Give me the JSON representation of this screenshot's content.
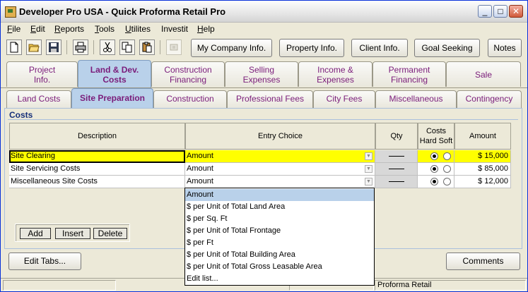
{
  "window": {
    "title": "Developer Pro  USA - Quick Proforma Retail Pro",
    "minimize_glyph": "_",
    "maximize_glyph": "□",
    "close_glyph": "✕"
  },
  "menu": [
    {
      "pre": "",
      "key": "F",
      "post": "ile"
    },
    {
      "pre": "",
      "key": "E",
      "post": "dit"
    },
    {
      "pre": "",
      "key": "R",
      "post": "eports"
    },
    {
      "pre": "",
      "key": "T",
      "post": "ools"
    },
    {
      "pre": "",
      "key": "U",
      "post": "tilites"
    },
    {
      "pre": "Investit",
      "key": "",
      "post": ""
    },
    {
      "pre": "",
      "key": "H",
      "post": "elp"
    }
  ],
  "toolbar": {
    "icons": [
      "new-document-icon",
      "open-folder-icon",
      "save-disk-icon",
      "print-icon",
      "cut-scissors-icon",
      "copy-icon",
      "paste-icon",
      "disabled-tool-icon"
    ],
    "my_company": "My Company Info.",
    "property": "Property Info.",
    "client": "Client Info.",
    "goal_seeking": "Goal Seeking",
    "notes": "Notes"
  },
  "main_tabs": [
    {
      "line1": "Project",
      "line2": "Info."
    },
    {
      "line1": "Land & Dev.",
      "line2": "Costs"
    },
    {
      "line1": "Construction",
      "line2": "Financing"
    },
    {
      "line1": "Selling",
      "line2": "Expenses"
    },
    {
      "line1": "Income &",
      "line2": "Expenses"
    },
    {
      "line1": "Permanent",
      "line2": "Financing"
    },
    {
      "line1": "Sale",
      "line2": ""
    }
  ],
  "sub_tabs": [
    "Land Costs",
    "Site Preparation",
    "Construction",
    "Professional Fees",
    "City Fees",
    "Miscellaneous",
    "Contingency"
  ],
  "section_label": "Costs",
  "grid": {
    "headers": {
      "description": "Description",
      "entry_choice": "Entry Choice",
      "qty": "Qty",
      "costs_line1": "Costs",
      "costs_line2": "Hard Soft",
      "amount": "Amount"
    },
    "rows": [
      {
        "description": "Site Clearing",
        "entry": "Amount",
        "hard_selected": true,
        "amount": "$ 15,000"
      },
      {
        "description": "Site Servicing Costs",
        "entry": "Amount",
        "hard_selected": true,
        "amount": "$ 85,000"
      },
      {
        "description": "Miscellaneous Site Costs",
        "entry": "Amount",
        "hard_selected": true,
        "amount": "$ 12,000"
      }
    ]
  },
  "row_buttons": {
    "add": "Add",
    "insert": "Insert",
    "delete": "Delete"
  },
  "dropdown_options": [
    "Amount",
    "$ per Unit of Total Land Area",
    "$ per Sq. Ft",
    "$ per Unit of Total Frontage",
    "$ per Ft",
    "$ per Unit of Total Building Area",
    "$ per Unit of Total Gross Leasable Area",
    "Edit list..."
  ],
  "bottom": {
    "edit_tabs": "Edit Tabs...",
    "comments": "Comments"
  },
  "status": {
    "pane1": "",
    "pane2": "",
    "pane3": "Proforma Retail"
  }
}
